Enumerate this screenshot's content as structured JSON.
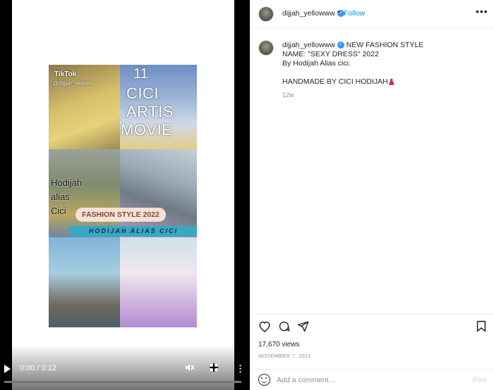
{
  "video": {
    "overlay": {
      "tiktok_logo": "TikTok",
      "handle": "@dijjah_yellow",
      "number": "11",
      "title_lines": [
        "CICI",
        "ARTIS",
        "MOVIE"
      ],
      "side_words": [
        "Hodijah",
        "alias",
        "Cici"
      ],
      "fashion_pill": "FASHION STYLE 2022",
      "band": "HODIJAH ALIAS CICI"
    },
    "time": "0:00 / 0:12",
    "progress": 0.0,
    "icons": {
      "play": "play-icon",
      "mute": "muted-speaker-icon",
      "fullscreen": "fullscreen-icon",
      "more": "more-vertical-icon"
    }
  },
  "header": {
    "username": "dijjah_yellowww",
    "dot": "•",
    "follow": "Follow",
    "more": "•••"
  },
  "caption": {
    "username": "dijjah_yellowww",
    "lines": [
      "NEW FASHION STYLE",
      "NAME: \"SEXY DRESS\" 2022",
      "By Hodijah Alias cici."
    ],
    "handmade": "HANDMADE BY CICI HODIJAH",
    "time": "12w"
  },
  "stats": {
    "views": "17,670 views",
    "date": "NOVEMBER 7, 2021"
  },
  "comment": {
    "placeholder": "Add a comment...",
    "post": "Post"
  },
  "colors": {
    "link": "#0095f6",
    "verified": "#3897f0",
    "post_disabled": "#b2dffc",
    "band": "#3aa7c5"
  }
}
